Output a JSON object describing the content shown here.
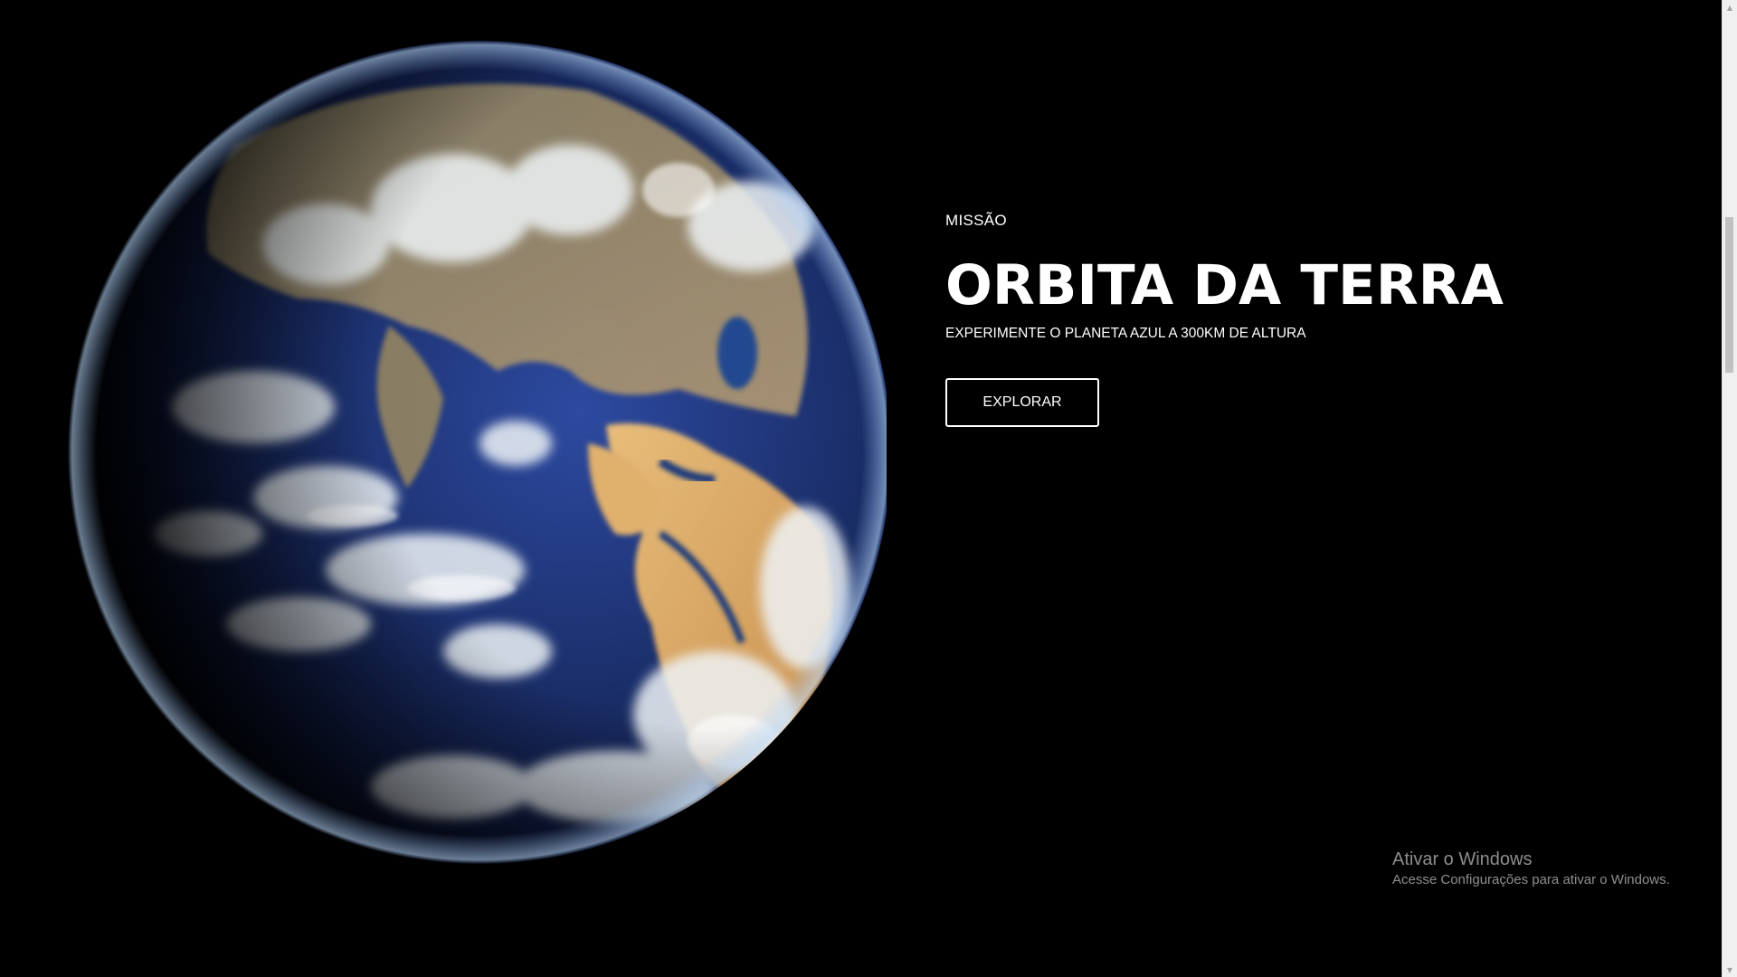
{
  "hero": {
    "eyebrow": "MISSÃO",
    "title": "ORBITA DA TERRA",
    "subtitle": "EXPERIMENTE O PLANETA AZUL A 300KM DE ALTURA",
    "cta_label": "EXPLORAR"
  },
  "earth": {
    "image": "earth-from-space"
  },
  "watermark": {
    "title": "Ativar o Windows",
    "subtitle": "Acesse Configurações para ativar o Windows."
  },
  "scrollbar": {
    "up_icon": "arrow-up-icon",
    "down_icon": "arrow-down-icon"
  },
  "colors": {
    "background": "#000000",
    "text": "#ffffff",
    "ocean": "#1b2f6b",
    "desert": "#d9a460",
    "cloud": "#e8eef2",
    "watermark": "#8c8c8c"
  }
}
